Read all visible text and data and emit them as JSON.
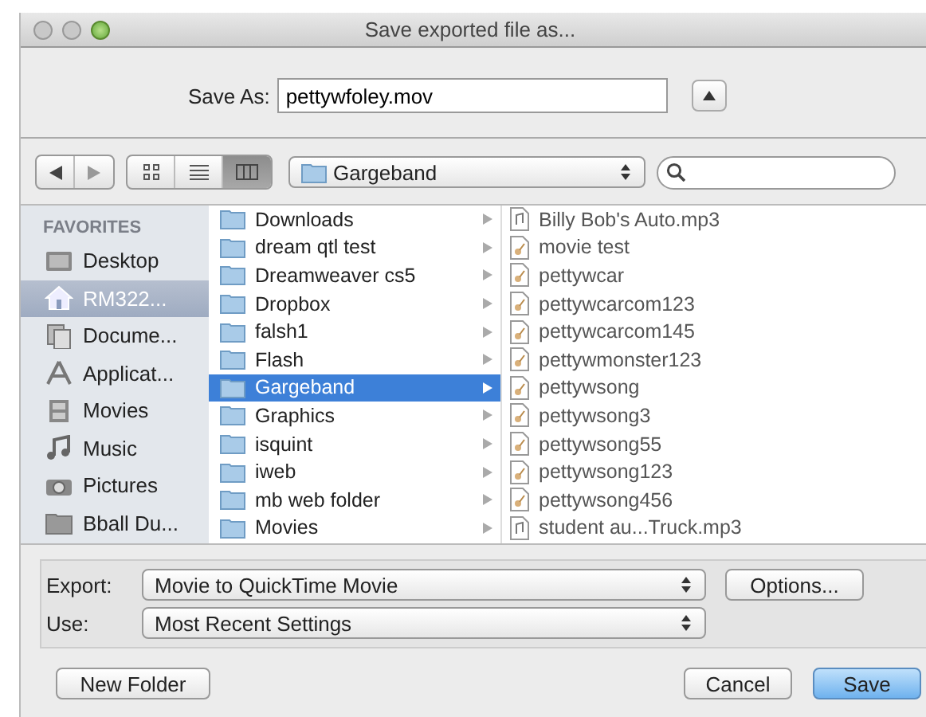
{
  "window": {
    "title": "Save exported file as..."
  },
  "save_as": {
    "label": "Save As:",
    "value": "pettywfoley.mov"
  },
  "view_modes": [
    {
      "kind": "icons",
      "selected": false
    },
    {
      "kind": "list",
      "selected": false
    },
    {
      "kind": "columns",
      "selected": true
    }
  ],
  "location": {
    "label": "Gargeband"
  },
  "sidebar": {
    "heading": "FAVORITES",
    "items": [
      {
        "label": "Desktop",
        "kind": "desktop",
        "selected": false
      },
      {
        "label": "RM322...",
        "kind": "home",
        "selected": true
      },
      {
        "label": "Docume...",
        "kind": "documents",
        "selected": false
      },
      {
        "label": "Applicat...",
        "kind": "apps",
        "selected": false
      },
      {
        "label": "Movies",
        "kind": "movies",
        "selected": false
      },
      {
        "label": "Music",
        "kind": "music",
        "selected": false
      },
      {
        "label": "Pictures",
        "kind": "pictures",
        "selected": false
      },
      {
        "label": "Bball Du...",
        "kind": "folder",
        "selected": false
      }
    ]
  },
  "columns": [
    {
      "items": [
        {
          "label": "Downloads",
          "kind": "folder",
          "selected": false
        },
        {
          "label": "dream qtl test",
          "kind": "folder",
          "selected": false
        },
        {
          "label": "Dreamweaver cs5",
          "kind": "folder",
          "selected": false
        },
        {
          "label": "Dropbox",
          "kind": "folder",
          "selected": false
        },
        {
          "label": "falsh1",
          "kind": "folder",
          "selected": false
        },
        {
          "label": "Flash",
          "kind": "folder",
          "selected": false
        },
        {
          "label": "Gargeband",
          "kind": "folder",
          "selected": true
        },
        {
          "label": "Graphics",
          "kind": "folder",
          "selected": false
        },
        {
          "label": "isquint",
          "kind": "folder",
          "selected": false
        },
        {
          "label": "iweb",
          "kind": "folder",
          "selected": false
        },
        {
          "label": "mb web folder",
          "kind": "folder",
          "selected": false
        },
        {
          "label": "Movies",
          "kind": "folder",
          "selected": false
        }
      ]
    },
    {
      "items": [
        {
          "label": "Billy Bob's Auto.mp3",
          "kind": "audio",
          "selected": false
        },
        {
          "label": "movie test",
          "kind": "project",
          "selected": false
        },
        {
          "label": "pettywcar",
          "kind": "project",
          "selected": false
        },
        {
          "label": "pettywcarcom123",
          "kind": "project",
          "selected": false
        },
        {
          "label": "pettywcarcom145",
          "kind": "project",
          "selected": false
        },
        {
          "label": "pettywmonster123",
          "kind": "project",
          "selected": false
        },
        {
          "label": "pettywsong",
          "kind": "project",
          "selected": false
        },
        {
          "label": "pettywsong3",
          "kind": "project",
          "selected": false
        },
        {
          "label": "pettywsong55",
          "kind": "project",
          "selected": false
        },
        {
          "label": "pettywsong123",
          "kind": "project",
          "selected": false
        },
        {
          "label": "pettywsong456",
          "kind": "project",
          "selected": false
        },
        {
          "label": "student au...Truck.mp3",
          "kind": "audio",
          "selected": false
        }
      ]
    }
  ],
  "export": {
    "label": "Export:",
    "value": "Movie to QuickTime Movie"
  },
  "options_button": "Options...",
  "use": {
    "label": "Use:",
    "value": "Most Recent Settings"
  },
  "new_folder_button": "New Folder",
  "cancel_button": "Cancel",
  "save_button": "Save"
}
